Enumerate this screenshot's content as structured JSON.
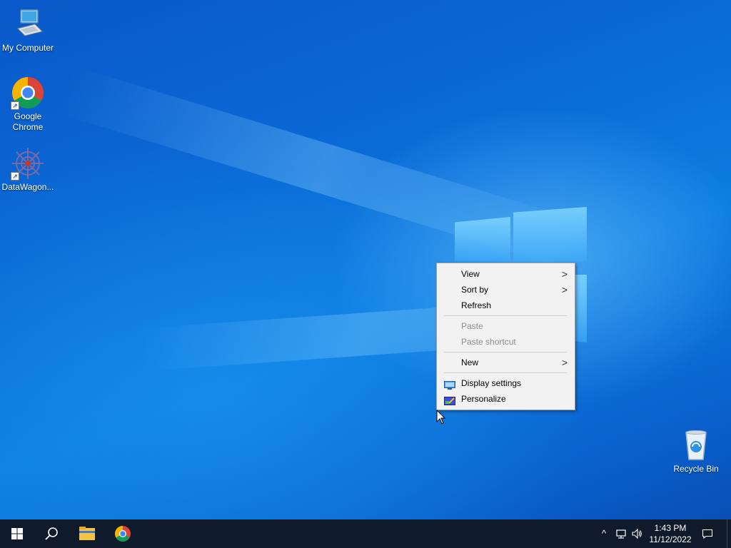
{
  "desktop": {
    "icons": [
      {
        "label": "My Computer",
        "icon": "computer-icon",
        "shortcut": false
      },
      {
        "label": "Google Chrome",
        "icon": "chrome-icon",
        "shortcut": true
      },
      {
        "label": "DataWagon...",
        "icon": "datawagon-icon",
        "shortcut": true
      },
      {
        "label": "Recycle Bin",
        "icon": "recycle-bin-icon",
        "shortcut": false
      }
    ]
  },
  "context_menu": {
    "items": [
      {
        "label": "View",
        "has_submenu": true,
        "enabled": true
      },
      {
        "label": "Sort by",
        "has_submenu": true,
        "enabled": true
      },
      {
        "label": "Refresh",
        "has_submenu": false,
        "enabled": true
      },
      {
        "label": "Paste",
        "has_submenu": false,
        "enabled": false
      },
      {
        "label": "Paste shortcut",
        "has_submenu": false,
        "enabled": false
      },
      {
        "label": "New",
        "has_submenu": true,
        "enabled": true
      },
      {
        "label": "Display settings",
        "icon": "display-icon",
        "enabled": true
      },
      {
        "label": "Personalize",
        "icon": "personalize-icon",
        "enabled": true
      }
    ],
    "chevron": ">"
  },
  "taskbar": {
    "pinned": [
      "start-icon",
      "search-icon",
      "file-explorer-icon",
      "chrome-icon"
    ],
    "clock": {
      "time": "1:43 PM",
      "date": "11/12/2022"
    },
    "tray_glyphs": {
      "chevron": "^",
      "volume": "🔊"
    }
  },
  "colors": {
    "taskbar_bg": "#0f1a2a",
    "menu_bg": "#f2f2f2",
    "disabled_text": "#8c8c8c",
    "accent": "#0a6fd8"
  }
}
